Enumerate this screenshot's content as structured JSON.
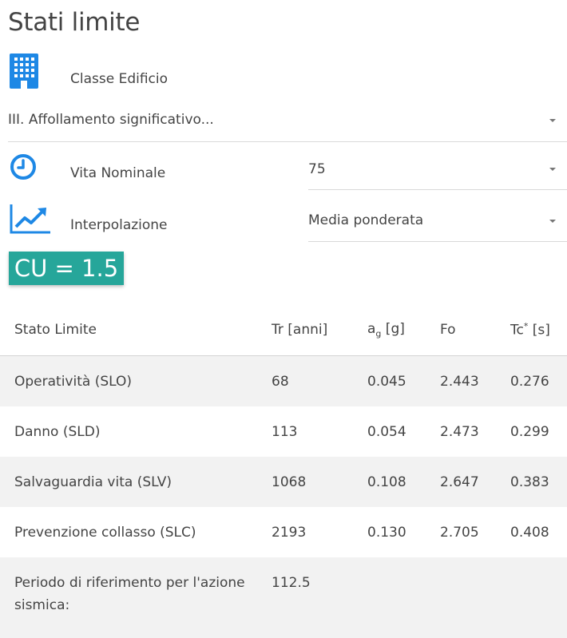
{
  "page": {
    "title": "Stati limite"
  },
  "classe": {
    "label": "Classe Edificio",
    "icon": "building-icon",
    "value": "III. Affollamento significativo..."
  },
  "vita": {
    "label": "Vita Nominale",
    "icon": "clock-icon",
    "value": "75"
  },
  "interpolazione": {
    "label": "Interpolazione",
    "icon": "trend-chart-icon",
    "value": "Media ponderata"
  },
  "cu": {
    "label": "CU = 1.5"
  },
  "table": {
    "headers": {
      "stato": "Stato Limite",
      "tr": "Tr [anni]",
      "ag_main": "a",
      "ag_sub": "g",
      "ag_unit": " [g]",
      "fo": "Fo",
      "tc_main": "Tc",
      "tc_sup": "*",
      "tc_unit": " [s]"
    },
    "rows": [
      {
        "stato": "Operatività (SLO)",
        "tr": "68",
        "ag": "0.045",
        "fo": "2.443",
        "tc": "0.276"
      },
      {
        "stato": "Danno (SLD)",
        "tr": "113",
        "ag": "0.054",
        "fo": "2.473",
        "tc": "0.299"
      },
      {
        "stato": "Salvaguardia vita (SLV)",
        "tr": "1068",
        "ag": "0.108",
        "fo": "2.647",
        "tc": "0.383"
      },
      {
        "stato": "Prevenzione collasso (SLC)",
        "tr": "2193",
        "ag": "0.130",
        "fo": "2.705",
        "tc": "0.408"
      }
    ],
    "reference": {
      "label": "Periodo di riferimento per l'azione sismica:",
      "value": "112.5"
    }
  },
  "colors": {
    "accent": "#26a69a",
    "icon_blue": "#1e88e5",
    "row_shade": "#f2f2f2"
  }
}
